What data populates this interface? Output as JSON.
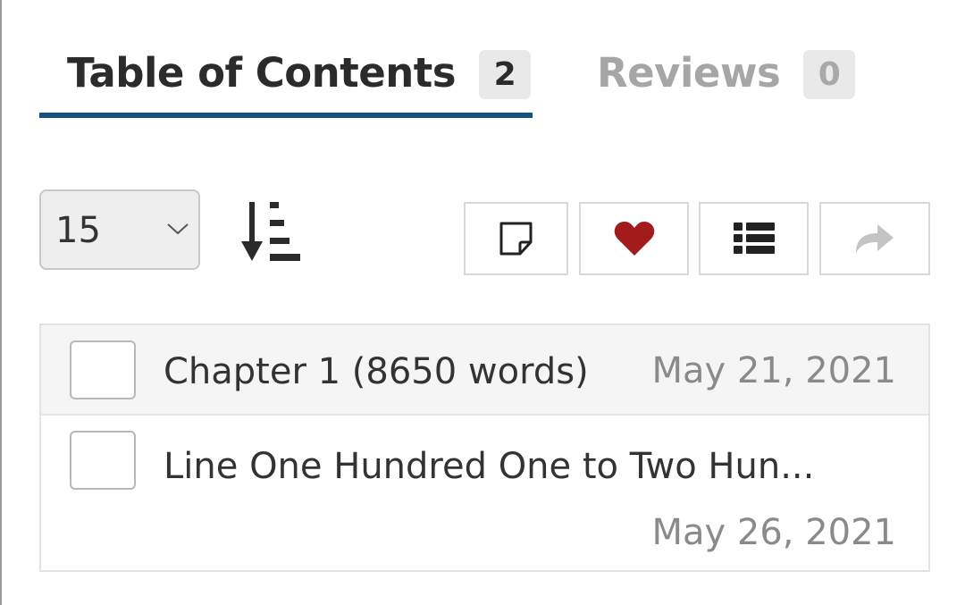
{
  "tabs": {
    "toc": {
      "label": "Table of Contents",
      "count": "2"
    },
    "reviews": {
      "label": "Reviews",
      "count": "0"
    }
  },
  "toolbar": {
    "per_page_value": "15",
    "sort_icon": "sort-descending-icon",
    "buttons": [
      {
        "icon": "note-icon"
      },
      {
        "icon": "heart-icon",
        "color": "#a31c1c"
      },
      {
        "icon": "list-icon"
      },
      {
        "icon": "share-arrow-icon"
      }
    ]
  },
  "chapters": [
    {
      "title": "Chapter 1 (8650 words)",
      "date": "May 21, 2021"
    },
    {
      "title": "Line One Hundred One to Two Hun...",
      "date": "May 26, 2021"
    }
  ],
  "colors": {
    "active_tab_underline": "#17527e",
    "heart": "#a31c1c",
    "inactive_text": "#a6a6a6"
  }
}
